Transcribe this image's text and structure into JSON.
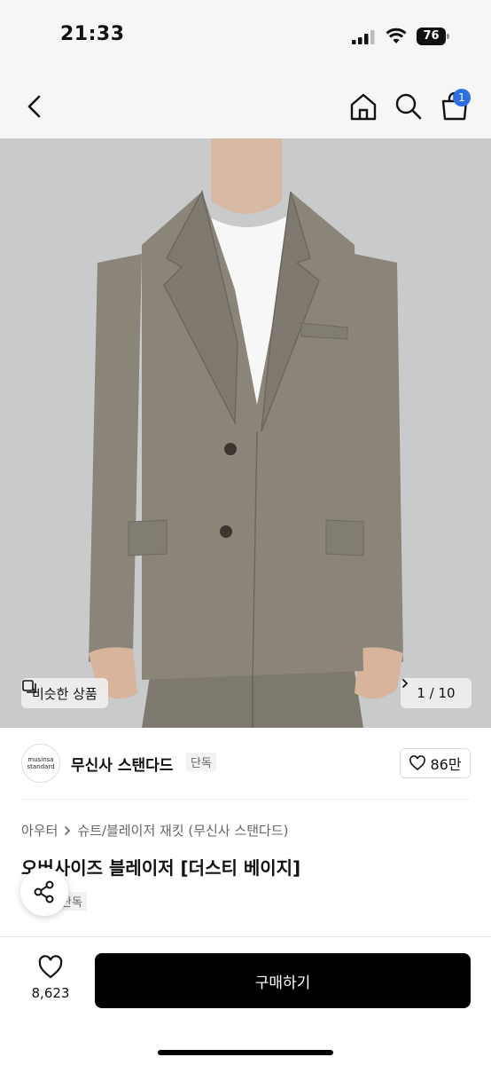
{
  "status": {
    "time": "21:33",
    "battery": "76"
  },
  "nav": {
    "back_icon": "chevron-left-icon",
    "home_icon": "home-icon",
    "search_icon": "search-icon",
    "cart_icon": "cart-icon",
    "cart_badge": "1"
  },
  "gallery": {
    "similar_label": "비슷한 상품",
    "page_indicator": "1 / 10"
  },
  "brand": {
    "logo_line1": "musinsa",
    "logo_line2": "standard",
    "name": "무신사 스탠다드",
    "tag": "단독",
    "likes": "86만"
  },
  "product": {
    "breadcrumb": [
      "아우터",
      "슈트/블레이저 재킷 (무신사 스탠다드)"
    ],
    "title": "오버사이즈 블레이저 [더스티 베이지]",
    "tag": "단독"
  },
  "bottom": {
    "wish_count": "8,623",
    "buy_label": "구매하기"
  },
  "colors": {
    "accent": "#2b6fe6",
    "jacket": "#8a8479",
    "background": "#c9cacc"
  }
}
